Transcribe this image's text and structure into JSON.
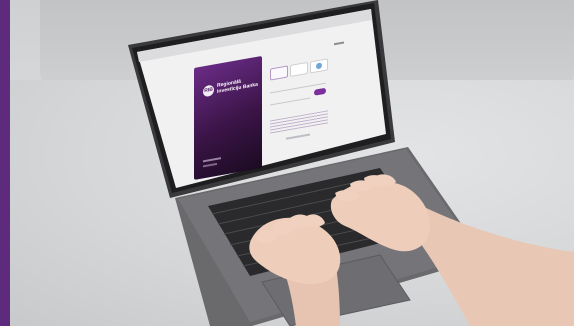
{
  "screen": {
    "card": {
      "logo_text": "RIB",
      "bank_name_line1": "Regionālā",
      "bank_name_line2": "investīciju Banka",
      "footer_line1": "",
      "footer_line2": ""
    },
    "login": {
      "tab1": "",
      "tab2": "",
      "tab3": "",
      "input1_placeholder": "",
      "input2_placeholder": "",
      "button": "",
      "top_link": ""
    }
  }
}
